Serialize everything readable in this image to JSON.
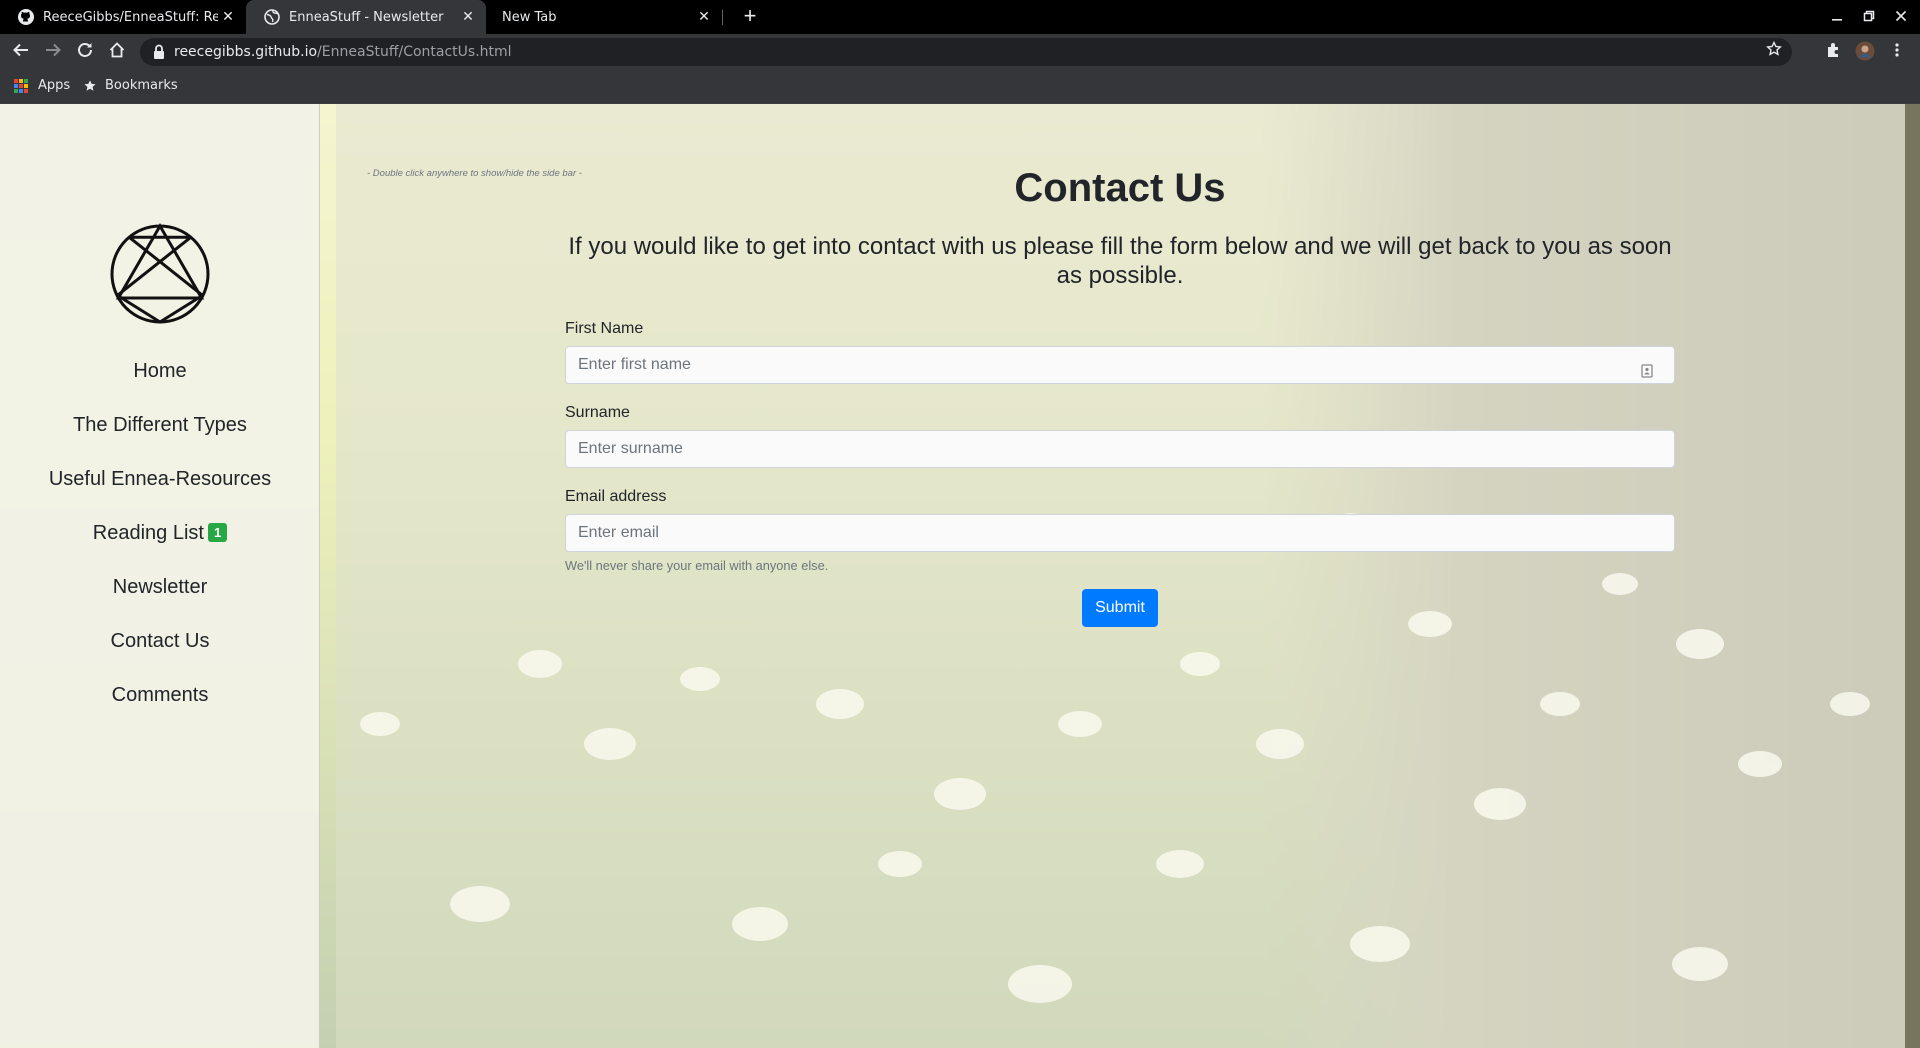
{
  "browser": {
    "tabs": [
      {
        "title": "ReeceGibbs/EnneaStuff: Rep",
        "active": false,
        "favicon": "github-icon"
      },
      {
        "title": "EnneaStuff - Newsletter",
        "active": true,
        "favicon": "globe-icon"
      },
      {
        "title": "New Tab",
        "active": false,
        "favicon": ""
      }
    ],
    "close_glyph": "✕",
    "newtab_glyph": "+",
    "url_host": "reecegibbs.github.io",
    "url_path": "/EnneaStuff/ContactUs.html",
    "bookmarks": [
      {
        "label": "Apps",
        "icon": "apps-grid-icon"
      },
      {
        "label": "Bookmarks",
        "icon": "star-icon"
      }
    ]
  },
  "sidebar": {
    "logo": "enneagram-icon",
    "items": [
      {
        "label": "Home"
      },
      {
        "label": "The Different Types"
      },
      {
        "label": "Useful Ennea-Resources"
      },
      {
        "label": "Reading List",
        "badge": "1"
      },
      {
        "label": "Newsletter"
      },
      {
        "label": "Contact Us"
      },
      {
        "label": "Comments"
      }
    ]
  },
  "hint": "- Double click anywhere to show/hide the side bar -",
  "main": {
    "title": "Contact Us",
    "intro": "If you would like to get into contact with us please fill the form below and we will get back to you as soon as possible.",
    "form": {
      "first_name_label": "First Name",
      "first_name_placeholder": "Enter first name",
      "surname_label": "Surname",
      "surname_placeholder": "Enter surname",
      "email_label": "Email address",
      "email_placeholder": "Enter email",
      "email_help": "We'll never share your email with anyone else.",
      "submit_label": "Submit"
    }
  },
  "colors": {
    "submit": "#007bff",
    "badge": "#28a745",
    "chrome_dark": "#35363a"
  }
}
